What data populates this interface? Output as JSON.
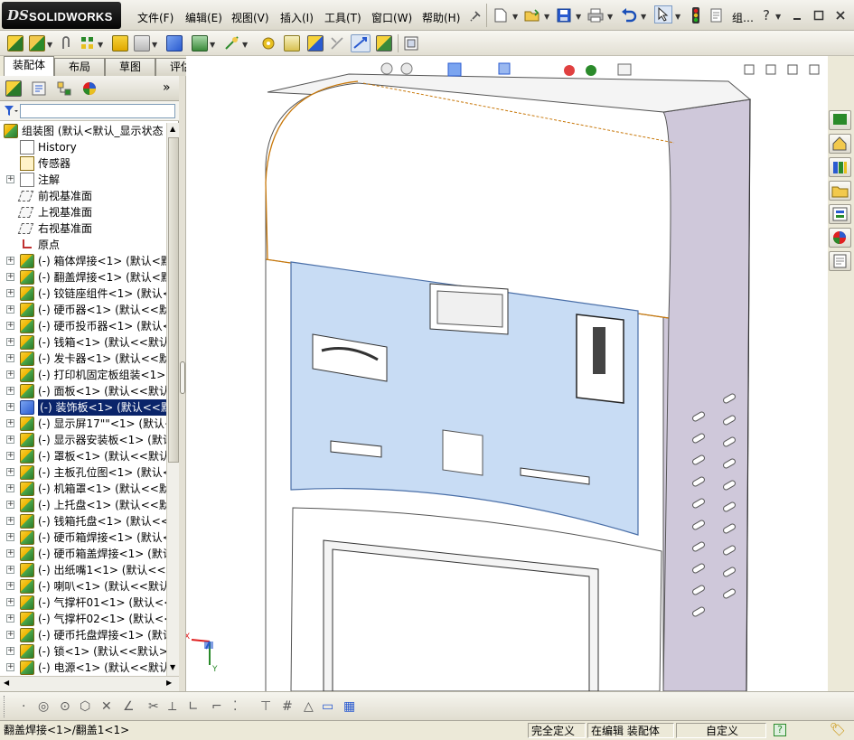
{
  "app": {
    "logo_ds": "DS",
    "logo_name": "SOLIDWORKS"
  },
  "menu": [
    "文件(F)",
    "编辑(E)",
    "视图(V)",
    "插入(I)",
    "工具(T)",
    "窗口(W)",
    "帮助(H)"
  ],
  "title_fragment": "组…",
  "command_tabs": [
    "装配体",
    "布局",
    "草图",
    "评估"
  ],
  "panel": {
    "collapse_glyph": "»"
  },
  "tree": {
    "root": "组装图 (默认<默认_显示状态",
    "items": [
      {
        "label": "History",
        "kind": "history"
      },
      {
        "label": "传感器",
        "kind": "sensor"
      },
      {
        "label": "注解",
        "kind": "annotation",
        "expand": "+"
      },
      {
        "label": "前视基准面",
        "kind": "plane"
      },
      {
        "label": "上视基准面",
        "kind": "plane"
      },
      {
        "label": "右视基准面",
        "kind": "plane"
      },
      {
        "label": "原点",
        "kind": "origin"
      },
      {
        "label": "(-) 箱体焊接<1> (默认<默",
        "kind": "part",
        "expand": "+"
      },
      {
        "label": "(-) 翻盖焊接<1> (默认<默",
        "kind": "part",
        "expand": "+"
      },
      {
        "label": "(-) 铰链座组件<1> (默认<",
        "kind": "part",
        "expand": "+"
      },
      {
        "label": "(-) 硬币器<1> (默认<<默认",
        "kind": "part",
        "expand": "+"
      },
      {
        "label": "(-) 硬币投币器<1> (默认<",
        "kind": "part",
        "expand": "+"
      },
      {
        "label": "(-) 钱箱<1> (默认<<默认>",
        "kind": "part",
        "expand": "+"
      },
      {
        "label": "(-) 发卡器<1> (默认<<默认",
        "kind": "part",
        "expand": "+"
      },
      {
        "label": "(-) 打印机固定板组装<1> (",
        "kind": "part",
        "expand": "+"
      },
      {
        "label": "(-) 面板<1> (默认<<默认>",
        "kind": "part",
        "expand": "+"
      },
      {
        "label": "(-) 装饰板<1> (默认<<默认",
        "kind": "part-selected",
        "expand": "+",
        "selected": true
      },
      {
        "label": "(-) 显示屏17\"\"<1> (默认<<",
        "kind": "part",
        "expand": "+"
      },
      {
        "label": "(-) 显示器安装板<1> (默认",
        "kind": "part",
        "expand": "+"
      },
      {
        "label": "(-) 罩板<1> (默认<<默认>",
        "kind": "part",
        "expand": "+"
      },
      {
        "label": "(-) 主板孔位图<1> (默认<",
        "kind": "part",
        "expand": "+"
      },
      {
        "label": "(-) 机箱罩<1> (默认<<默认",
        "kind": "part",
        "expand": "+"
      },
      {
        "label": "(-) 上托盘<1> (默认<<默认",
        "kind": "part",
        "expand": "+"
      },
      {
        "label": "(-) 钱箱托盘<1> (默认<<默",
        "kind": "part",
        "expand": "+"
      },
      {
        "label": "(-) 硬币箱焊接<1> (默认<",
        "kind": "part",
        "expand": "+"
      },
      {
        "label": "(-) 硬币箱盖焊接<1> (默认",
        "kind": "part",
        "expand": "+"
      },
      {
        "label": "(-) 出纸嘴1<1> (默认<<默",
        "kind": "part",
        "expand": "+"
      },
      {
        "label": "(-) 喇叭<1> (默认<<默认>",
        "kind": "part",
        "expand": "+"
      },
      {
        "label": "(-) 气撑杆01<1> (默认<<默",
        "kind": "part",
        "expand": "+"
      },
      {
        "label": "(-) 气撑杆02<1> (默认<<默",
        "kind": "part",
        "expand": "+"
      },
      {
        "label": "(-) 硬币托盘焊接<1> (默认",
        "kind": "part",
        "expand": "+"
      },
      {
        "label": "(-) 锁<1> (默认<<默认>_显",
        "kind": "part",
        "expand": "+"
      },
      {
        "label": "(-) 电源<1> (默认<<默认>",
        "kind": "part",
        "expand": "+"
      }
    ]
  },
  "triad": {
    "x": "X",
    "y": "Y"
  },
  "status": {
    "path": "翻盖焊接<1>/翻盖1<1>",
    "state": "完全定义",
    "mode": "在编辑 装配体",
    "custom": "自定义",
    "help": "?"
  },
  "colors": {
    "selection": "#0a246a",
    "panel_fill": "#c8dcf4",
    "edge_highlight": "#c8780a"
  }
}
